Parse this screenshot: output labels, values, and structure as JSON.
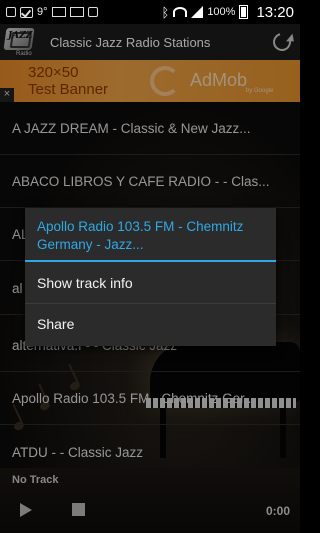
{
  "status_bar": {
    "temperature": "9°",
    "battery": "100%",
    "time": "13:20",
    "signal_icons": [
      "facebook-icon",
      "check-icon",
      "mail-icon",
      "gmail-icon",
      "calendar-icon",
      "bluetooth-icon",
      "wifi-icon",
      "signal-icon",
      "battery-icon"
    ]
  },
  "action_bar": {
    "logo_text": "JAZZ",
    "logo_sub": "Radio",
    "title": "Classic Jazz Radio Stations",
    "refresh_icon": "refresh-icon"
  },
  "ad": {
    "size_text": "320×50",
    "label": "Test Banner",
    "brand": "AdMob",
    "by": "by Google",
    "close": "×"
  },
  "stations": [
    "A JAZZ DREAM - Classic & New Jazz...",
    "ABACO LIBROS Y CAFE RADIO - - Clas...",
    "AL",
    "al",
    "alternativa.f - - Classic Jazz",
    "Apollo Radio 103.5 FM - Chemnitz Ger...",
    "ATDU - - Classic Jazz"
  ],
  "context_menu": {
    "title": "Apollo Radio 103.5 FM - Chemnitz Germany - Jazz...",
    "items": [
      "Show track info",
      "Share"
    ]
  },
  "player": {
    "track": "No Track",
    "time": "0:00",
    "play_icon": "play-icon",
    "stop_icon": "stop-icon"
  },
  "colors": {
    "accent": "#2fa9e6",
    "menu_bg": "#2b2b2b",
    "ad_bg": "#f2a548"
  }
}
